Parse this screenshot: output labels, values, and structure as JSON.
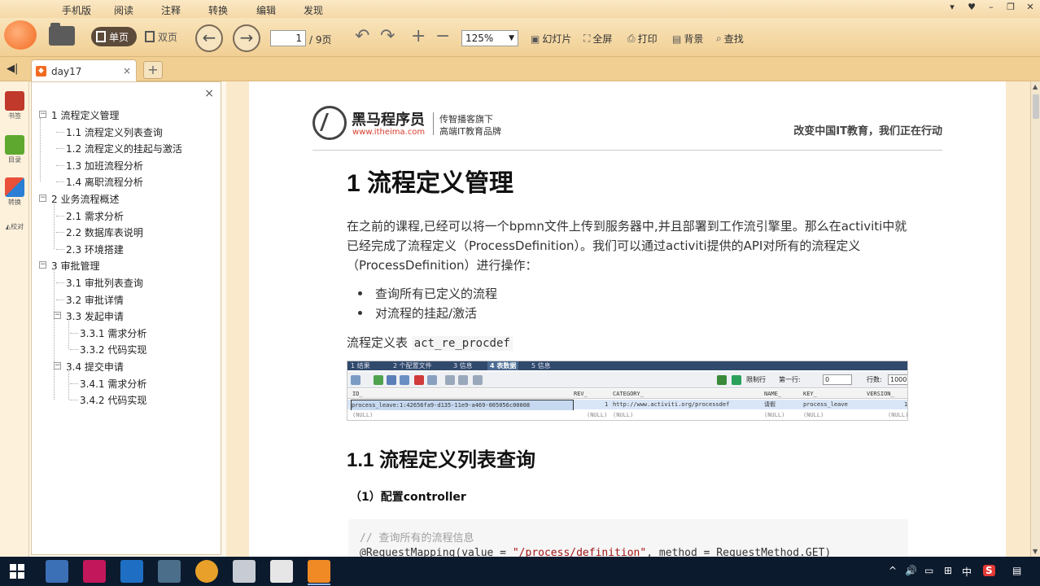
{
  "menu": [
    "手机版",
    "阅读",
    "注释",
    "转换",
    "编辑",
    "发现"
  ],
  "window_controls": [
    "▾",
    "♥",
    "–",
    "❐",
    "✕"
  ],
  "toolbar": {
    "single_page": "单页",
    "double_page": "双页",
    "prev": "←",
    "next": "→",
    "page_value": "1",
    "page_total": "/ 9页",
    "rotate_left": "↶",
    "rotate_right": "↷",
    "zoom_in": "+",
    "zoom_out": "−",
    "zoom": "125%",
    "slideshow": "幻灯片",
    "fullscreen": "全屏",
    "print": "打印",
    "background": "背景",
    "find": "查找"
  },
  "tabs": {
    "doc_tab": "day17",
    "close": "×",
    "new_tab": "+",
    "toggle": "◀|"
  },
  "rail": [
    {
      "label": "书签",
      "color": "#c0392b"
    },
    {
      "label": "目录",
      "color": "#5fa830"
    },
    {
      "label": "转换",
      "color": "#e8503a"
    },
    {
      "label": "◭校对",
      "color": ""
    }
  ],
  "outline": {
    "close": "×",
    "items": [
      {
        "text": "1 流程定义管理",
        "level": 0,
        "expandable": true
      },
      {
        "text": "1.1 流程定义列表查询",
        "level": 1,
        "expandable": false
      },
      {
        "text": "1.2 流程定义的挂起与激活",
        "level": 1,
        "expandable": false
      },
      {
        "text": "1.3 加班流程分析",
        "level": 1,
        "expandable": false
      },
      {
        "text": "1.4 离职流程分析",
        "level": 1,
        "expandable": false
      },
      {
        "text": "2 业务流程概述",
        "level": 0,
        "expandable": true
      },
      {
        "text": "2.1 需求分析",
        "level": 1,
        "expandable": false
      },
      {
        "text": "2.2 数据库表说明",
        "level": 1,
        "expandable": false
      },
      {
        "text": "2.3 环境搭建",
        "level": 1,
        "expandable": false
      },
      {
        "text": "3 审批管理",
        "level": 0,
        "expandable": true
      },
      {
        "text": "3.1 审批列表查询",
        "level": 1,
        "expandable": false
      },
      {
        "text": "3.2 审批详情",
        "level": 1,
        "expandable": false
      },
      {
        "text": "3.3 发起申请",
        "level": 1,
        "expandable": true
      },
      {
        "text": "3.3.1 需求分析",
        "level": 2,
        "expandable": false
      },
      {
        "text": "3.3.2 代码实现",
        "level": 2,
        "expandable": false
      },
      {
        "text": "3.4 提交申请",
        "level": 1,
        "expandable": true
      },
      {
        "text": "3.4.1 需求分析",
        "level": 2,
        "expandable": false
      },
      {
        "text": "3.4.2 代码实现",
        "level": 2,
        "expandable": false
      }
    ]
  },
  "page": {
    "brand_name": "黑马程序员",
    "brand_url": "www.itheima.com",
    "brand_tag1": "传智播客旗下",
    "brand_tag2": "高端IT教育品牌",
    "slogan": "改变中国IT教育，我们正在行动",
    "h1": "1 流程定义管理",
    "para1": "在之前的课程,已经可以将一个bpmn文件上传到服务器中,并且部署到工作流引擎里。那么在activiti中就已经完成了流程定义（ProcessDefinition）。我们可以通过activiti提供的API对所有的流程定义（ProcessDefinition）进行操作：",
    "bullets": [
      "查询所有已定义的流程",
      "对流程的挂起/激活"
    ],
    "table_caption_prefix": "流程定义表",
    "table_caption_code": "act_re_procdef",
    "h2": "1.1 流程定义列表查询",
    "h3": "（1）配置controller",
    "code_comment": "// 查询所有的流程信息",
    "code_line_prefix": "@RequestMapping(value = ",
    "code_line_string": "\"/process/definition\"",
    "code_line_suffix": ", method = RequestMethod.GET)"
  },
  "dbshot": {
    "tabs": [
      "1 结果",
      "2 个配置文件",
      "3 信息",
      "4 表数据",
      "5 信息"
    ],
    "filter_label": "限制行",
    "first_row_label": "第一行:",
    "first_row_value": "0",
    "rows_label": "行数:",
    "rows_value": "1000",
    "headers": [
      "ID_",
      "REV_",
      "CATEGORY_",
      "NAME_",
      "KEY_",
      "VERSION_"
    ],
    "row1": [
      "process_leave:1:42656fa9-d135-11e9-a469-005056c00008",
      "1",
      "http://www.activiti.org/processdef",
      "请假",
      "process_leave",
      "1"
    ],
    "row2": [
      "(NULL)",
      "(NULL)",
      "(NULL)",
      "(NULL)",
      "(NULL)",
      "(NULL)"
    ]
  },
  "taskbar": {
    "tray": [
      "^",
      "🔊",
      "中",
      "S",
      "▤"
    ]
  }
}
